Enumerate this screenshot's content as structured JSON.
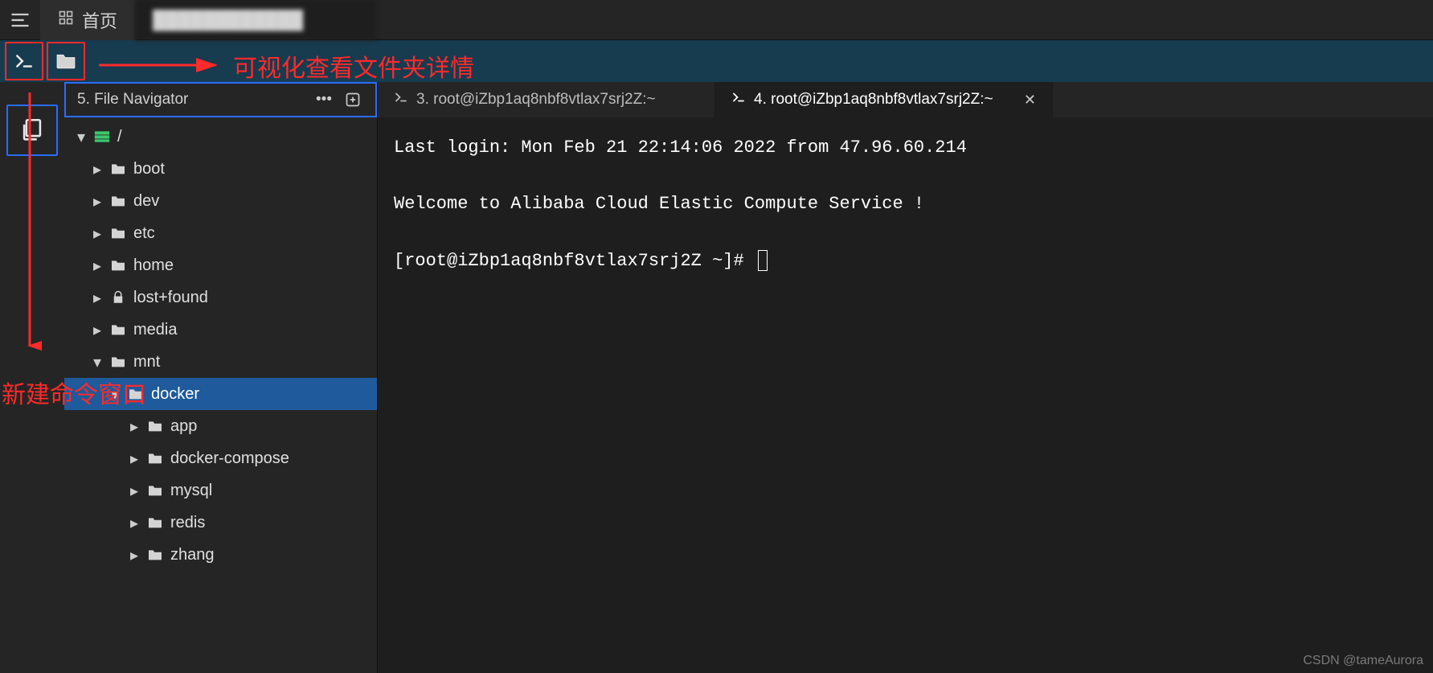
{
  "top": {
    "home_label": "首页",
    "blurred_tab": "████████████"
  },
  "file_nav": {
    "title": "5. File Navigator",
    "root": "/",
    "items": [
      {
        "label": "boot",
        "icon": "folder",
        "indent": 1,
        "expanded": false
      },
      {
        "label": "dev",
        "icon": "folder",
        "indent": 1,
        "expanded": false
      },
      {
        "label": "etc",
        "icon": "folder",
        "indent": 1,
        "expanded": false
      },
      {
        "label": "home",
        "icon": "folder",
        "indent": 1,
        "expanded": false
      },
      {
        "label": "lost+found",
        "icon": "lock",
        "indent": 1,
        "expanded": false
      },
      {
        "label": "media",
        "icon": "folder",
        "indent": 1,
        "expanded": false
      },
      {
        "label": "mnt",
        "icon": "folder",
        "indent": 1,
        "expanded": true
      },
      {
        "label": "docker",
        "icon": "folder",
        "indent": 2,
        "expanded": true,
        "selected": true
      },
      {
        "label": "app",
        "icon": "folder",
        "indent": 3,
        "expanded": false
      },
      {
        "label": "docker-compose",
        "icon": "folder",
        "indent": 3,
        "expanded": false
      },
      {
        "label": "mysql",
        "icon": "folder",
        "indent": 3,
        "expanded": false
      },
      {
        "label": "redis",
        "icon": "folder",
        "indent": 3,
        "expanded": false
      },
      {
        "label": "zhang",
        "icon": "folder",
        "indent": 3,
        "expanded": false
      }
    ]
  },
  "editor_tabs": {
    "tab1": "3. root@iZbp1aq8nbf8vtlax7srj2Z:~",
    "tab2": "4. root@iZbp1aq8nbf8vtlax7srj2Z:~"
  },
  "terminal": {
    "line1": "Last login: Mon Feb 21 22:14:06 2022 from 47.96.60.214",
    "line2": "Welcome to Alibaba Cloud Elastic Compute Service !",
    "prompt": "[root@iZbp1aq8nbf8vtlax7srj2Z ~]# "
  },
  "annotations": {
    "top_right": "可视化查看文件夹详情",
    "bottom_left": "新建命令窗口"
  },
  "watermark": "CSDN @tameAurora"
}
